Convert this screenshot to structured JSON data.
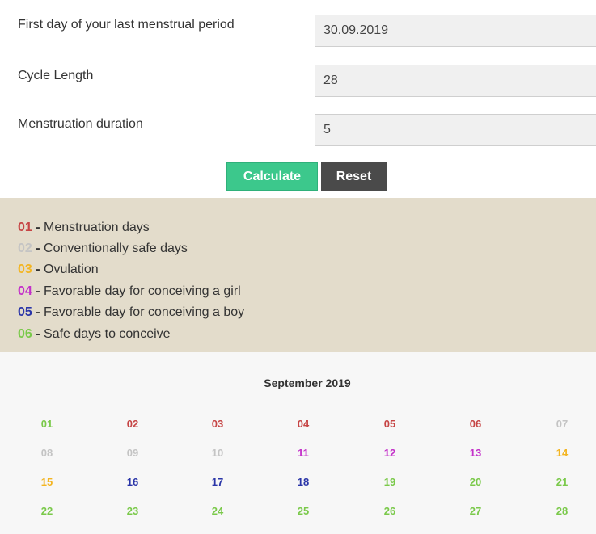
{
  "form": {
    "period_label": "First day of your last menstrual period",
    "period_value": "30.09.2019",
    "cycle_label": "Cycle Length",
    "cycle_value": "28",
    "duration_label": "Menstruation duration",
    "duration_value": "5",
    "calculate_label": "Calculate",
    "reset_label": "Reset"
  },
  "legend": {
    "items": [
      {
        "num": "01",
        "dash": " - ",
        "text": "Menstruation days",
        "color": "#c64545"
      },
      {
        "num": "02",
        "dash": " - ",
        "text": "Conventionally safe days",
        "color": "#c4c4c4"
      },
      {
        "num": "03",
        "dash": " - ",
        "text": "Ovulation",
        "color": "#f3b522"
      },
      {
        "num": "04",
        "dash": " - ",
        "text": "Favorable day for conceiving a girl",
        "color": "#c330c9"
      },
      {
        "num": "05",
        "dash": " - ",
        "text": "Favorable day for conceiving a boy",
        "color": "#2a35a8"
      },
      {
        "num": "06",
        "dash": " - ",
        "text": "Safe days to conceive",
        "color": "#7ac94a"
      }
    ]
  },
  "calendar": {
    "title": "September 2019",
    "weeks": [
      [
        {
          "d": "01",
          "t": "conceive"
        },
        {
          "d": "02",
          "t": "menstruation"
        },
        {
          "d": "03",
          "t": "menstruation"
        },
        {
          "d": "04",
          "t": "menstruation"
        },
        {
          "d": "05",
          "t": "menstruation"
        },
        {
          "d": "06",
          "t": "menstruation"
        },
        {
          "d": "07",
          "t": "safe"
        }
      ],
      [
        {
          "d": "08",
          "t": "safe"
        },
        {
          "d": "09",
          "t": "safe"
        },
        {
          "d": "10",
          "t": "safe"
        },
        {
          "d": "11",
          "t": "girl"
        },
        {
          "d": "12",
          "t": "girl"
        },
        {
          "d": "13",
          "t": "girl"
        },
        {
          "d": "14",
          "t": "ovulation"
        }
      ],
      [
        {
          "d": "15",
          "t": "ovulation"
        },
        {
          "d": "16",
          "t": "boy"
        },
        {
          "d": "17",
          "t": "boy"
        },
        {
          "d": "18",
          "t": "boy"
        },
        {
          "d": "19",
          "t": "conceive"
        },
        {
          "d": "20",
          "t": "conceive"
        },
        {
          "d": "21",
          "t": "conceive"
        }
      ],
      [
        {
          "d": "22",
          "t": "conceive"
        },
        {
          "d": "23",
          "t": "conceive"
        },
        {
          "d": "24",
          "t": "conceive"
        },
        {
          "d": "25",
          "t": "conceive"
        },
        {
          "d": "26",
          "t": "conceive"
        },
        {
          "d": "27",
          "t": "conceive"
        },
        {
          "d": "28",
          "t": "conceive"
        }
      ]
    ]
  }
}
